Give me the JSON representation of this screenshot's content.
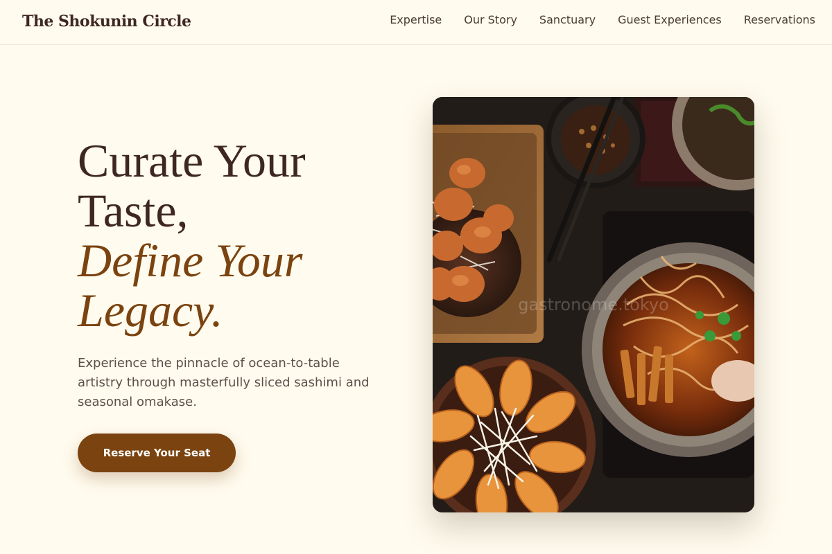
{
  "header": {
    "brand": "The Shokunin Circle",
    "nav": [
      {
        "label": "Expertise"
      },
      {
        "label": "Our Story"
      },
      {
        "label": "Sanctuary"
      },
      {
        "label": "Guest Experiences"
      },
      {
        "label": "Reservations"
      }
    ]
  },
  "hero": {
    "title_line1": "Curate Your Taste,",
    "title_line2": "Define Your Legacy.",
    "subtitle": "Experience the pinnacle of ocean-to-table artistry through masterfully sliced sashimi and seasonal omakase.",
    "cta_label": "Reserve Your Seat",
    "image": {
      "watermark": "gastronome.tokyo"
    }
  },
  "colors": {
    "background": "#fffbee",
    "text": "#3e2723",
    "accent": "#7a4310"
  }
}
